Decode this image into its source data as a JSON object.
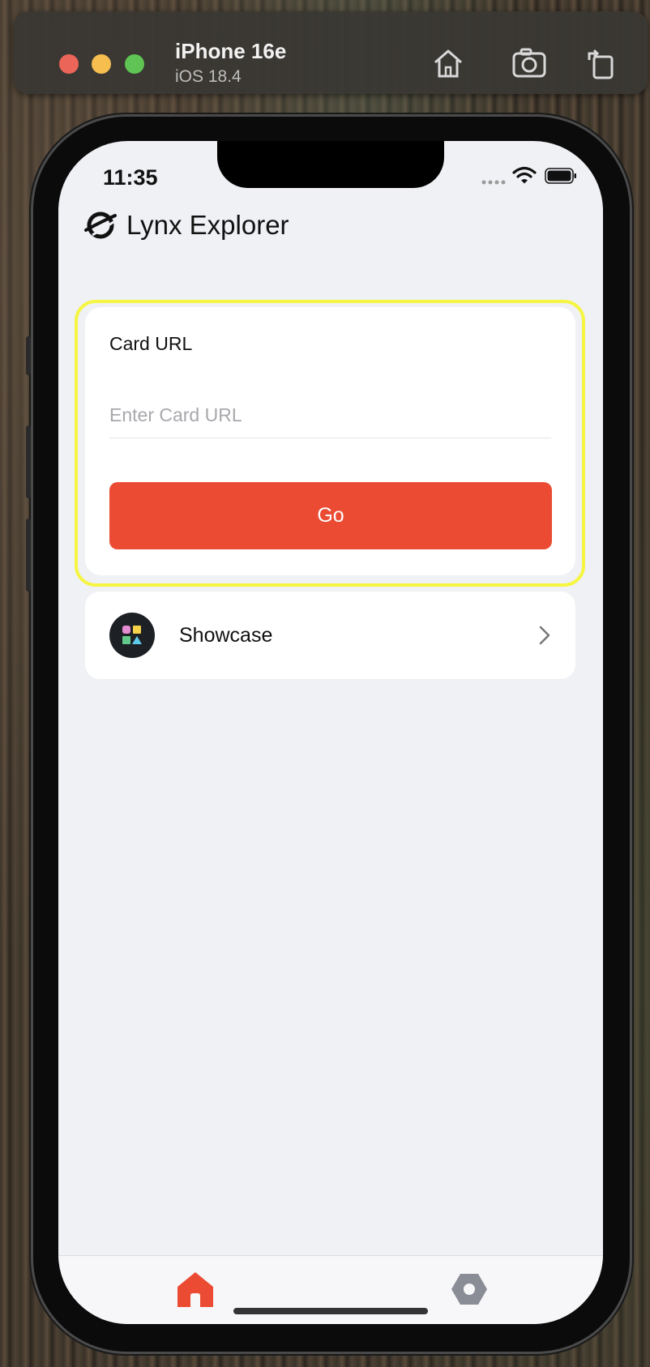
{
  "simulator": {
    "device_name": "iPhone 16e",
    "os_version": "iOS 18.4"
  },
  "status_bar": {
    "time": "11:35"
  },
  "header": {
    "title": "Lynx Explorer",
    "logo_icon": "lynx-logo-icon"
  },
  "card": {
    "label": "Card URL",
    "input_placeholder": "Enter Card URL",
    "input_value": "",
    "button_label": "Go"
  },
  "showcase": {
    "label": "Showcase",
    "icon": "shapes-icon"
  },
  "tab_bar": {
    "items": [
      {
        "name": "home",
        "icon": "home-icon",
        "active": true
      },
      {
        "name": "settings",
        "icon": "settings-icon",
        "active": false
      }
    ]
  },
  "colors": {
    "accent": "#eb4b33",
    "highlight": "#f5f542",
    "background": "#f0f1f5"
  }
}
